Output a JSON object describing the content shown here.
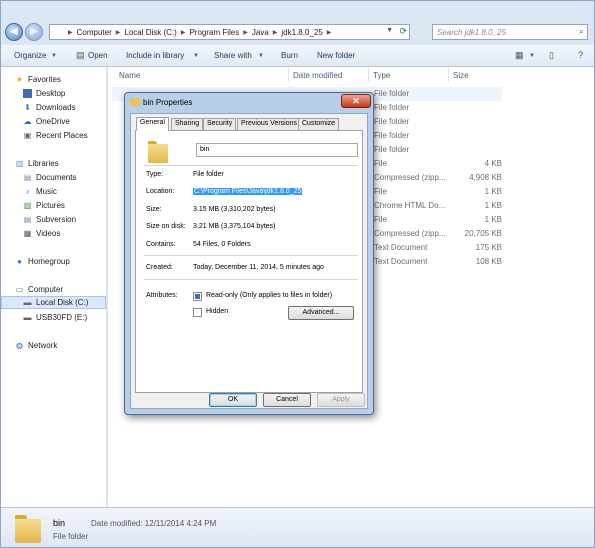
{
  "address": {
    "crumbs": [
      "Computer",
      "Local Disk (C:)",
      "Program Files",
      "Java",
      "jdk1.8.0_25"
    ],
    "search_placeholder": "Search jdk1.8.0_25"
  },
  "toolbar": {
    "organize": "Organize",
    "open": "Open",
    "include_in_library": "Include in library",
    "share_with": "Share with",
    "burn": "Burn",
    "new_folder": "New folder"
  },
  "nav": {
    "favorites": "Favorites",
    "desktop": "Desktop",
    "downloads": "Downloads",
    "onedrive": "OneDrive",
    "recent_places": "Recent Places",
    "libraries": "Libraries",
    "documents": "Documents",
    "music": "Music",
    "pictures": "Pictures",
    "subversion": "Subversion",
    "videos": "Videos",
    "homegroup": "Homegroup",
    "computer": "Computer",
    "local_disk": "Local Disk (C:)",
    "usb": "USB30FD (E:)",
    "network": "Network"
  },
  "columns": {
    "name": "Name",
    "date_modified": "Date modified",
    "type": "Type",
    "size": "Size"
  },
  "rows": [
    {
      "type": "File folder",
      "size": ""
    },
    {
      "type": "File folder",
      "size": ""
    },
    {
      "type": "File folder",
      "size": ""
    },
    {
      "type": "File folder",
      "size": ""
    },
    {
      "type": "File folder",
      "size": ""
    },
    {
      "type": "File",
      "size": "4 KB"
    },
    {
      "type": "Compressed (zipp...",
      "size": "4,908 KB"
    },
    {
      "type": "File",
      "size": "1 KB"
    },
    {
      "type": "Chrome HTML Do...",
      "size": "1 KB"
    },
    {
      "type": "File",
      "size": "1 KB"
    },
    {
      "type": "Compressed (zipp...",
      "size": "20,705 KB"
    },
    {
      "type": "Text Document",
      "size": "175 KB"
    },
    {
      "type": "Text Document",
      "size": "108 KB"
    }
  ],
  "details": {
    "name": "bin",
    "type": "File folder",
    "modified": "Date modified: 12/11/2014 4:24 PM"
  },
  "dialog": {
    "title": "bin Properties",
    "tabs": [
      "General",
      "Sharing",
      "Security",
      "Previous Versions",
      "Customize"
    ],
    "name": "bin",
    "type_label": "Type:",
    "type_value": "File folder",
    "location_label": "Location:",
    "location_value": "C:\\Program Files\\Java\\jdk1.8.0_25",
    "size_label": "Size:",
    "size_value": "3.15 MB (3,310,202 bytes)",
    "size_on_disk_label": "Size on disk:",
    "size_on_disk_value": "3.21 MB (3,375,104 bytes)",
    "contains_label": "Contains:",
    "contains_value": "54 Files, 0 Folders",
    "created_label": "Created:",
    "created_value": "Today, December 11, 2014, 5 minutes ago",
    "attributes_label": "Attributes:",
    "readonly_label": "Read-only (Only applies to files in folder)",
    "hidden_label": "Hidden",
    "advanced": "Advanced...",
    "ok": "OK",
    "cancel": "Cancel",
    "apply": "Apply",
    "close_glyph": "✕"
  }
}
